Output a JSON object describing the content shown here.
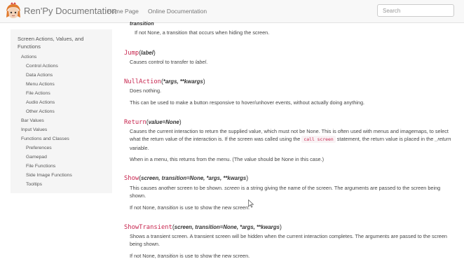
{
  "header": {
    "brand": "Ren'Py Documentation",
    "nav": [
      "Home Page",
      "Online Documentation"
    ],
    "search_placeholder": "Search"
  },
  "sidebar": {
    "title": "Screen Actions, Values, and Functions",
    "items": [
      "Actions",
      "Control Actions",
      "Data Actions",
      "Menu Actions",
      "File Actions",
      "Audio Actions",
      "Other Actions",
      "Bar Values",
      "Input Values",
      "Functions and Classes",
      "Preferences",
      "Gamepad",
      "File Functions",
      "Side Image Functions",
      "Tooltips"
    ]
  },
  "content": {
    "top_term": "transition",
    "top_desc": "If not None, a transition that occurs when hiding the screen.",
    "jump": {
      "name": "Jump",
      "open": "(",
      "params": "label",
      "close": ")",
      "desc_pre": "Causes control to transfer to ",
      "desc_em": "label",
      "desc_post": "."
    },
    "nullaction": {
      "name": "NullAction",
      "open": "(",
      "params": "*args, **kwargs",
      "close": ")",
      "desc1": "Does nothing.",
      "desc2": "This can be used to make a button responsive to hover/unhover events, without actually doing anything."
    },
    "return": {
      "name": "Return",
      "open": "(",
      "params": "value=None",
      "close": ")",
      "desc_a": "Causes the current interaction to return the supplied value, which must not be None. This is often used with menus and imagemaps, to select what the return value of the interaction is. If the screen was called using the",
      "desc_code": "call screen",
      "desc_b": "statement, the return value is placed in the",
      "desc_em": "_return",
      "desc_c": "variable.",
      "desc2": "When in a menu, this returns from the menu. (The value should be None in this case.)"
    },
    "show": {
      "name": "Show",
      "open": "(",
      "params": "screen, transition=None, *args, **kwargs",
      "close": ")",
      "desc_a": "This causes another screen to be shown.",
      "desc_em": "screen",
      "desc_b": "is a string giving the name of the screen. The arguments are passed to the screen being shown.",
      "desc2_a": "If not None,",
      "desc2_em": "transition",
      "desc2_b": "is use to show the new screen."
    },
    "showtransient": {
      "name": "ShowTransient",
      "open": "(",
      "params": "screen, transition=None, *args, **kwargs",
      "close": ")",
      "desc": "Shows a transient screen. A transient screen will be hidden when the current interaction completes. The arguments are passed to the screen being shown.",
      "desc2_a": "If not None,",
      "desc2_em": "transition",
      "desc2_b": "is use to show the new screen."
    }
  }
}
